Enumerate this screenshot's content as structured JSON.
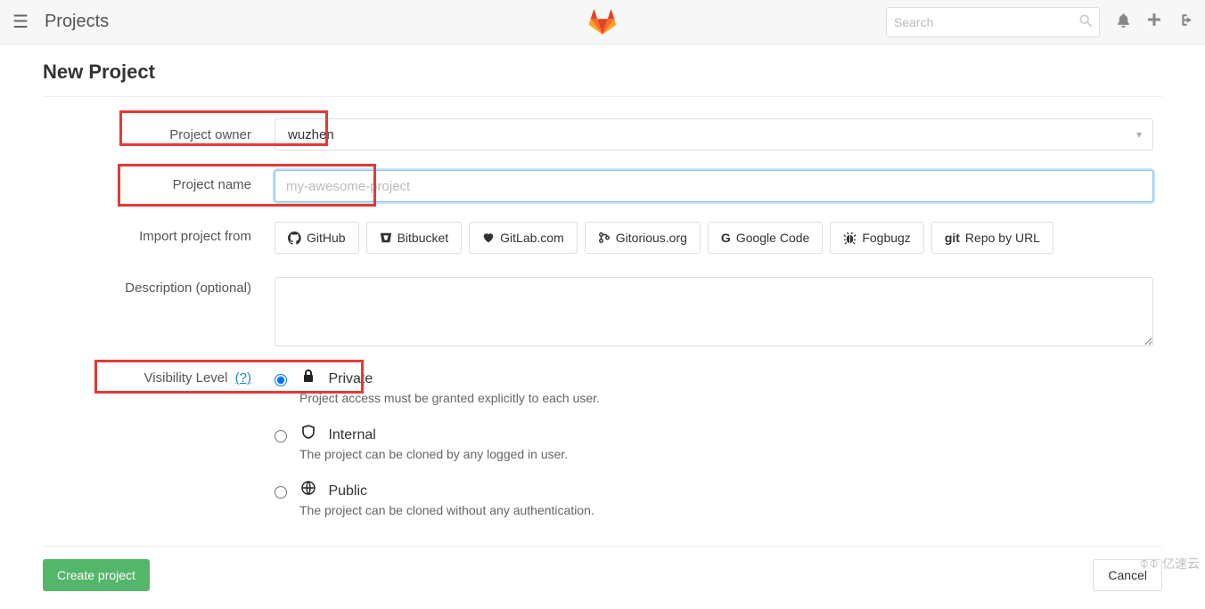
{
  "nav": {
    "title": "Projects",
    "search_placeholder": "Search"
  },
  "page": {
    "title": "New Project"
  },
  "form": {
    "owner": {
      "label": "Project owner",
      "selected_value": "wuzhen"
    },
    "name": {
      "label": "Project name",
      "placeholder": "my-awesome-project",
      "value": ""
    },
    "import": {
      "label": "Import project from",
      "sources": [
        {
          "icon": "github",
          "label": "GitHub"
        },
        {
          "icon": "bitbucket",
          "label": "Bitbucket"
        },
        {
          "icon": "gitlab",
          "label": "GitLab.com"
        },
        {
          "icon": "gitorious",
          "label": "Gitorious.org"
        },
        {
          "icon": "google",
          "label": "Google Code"
        },
        {
          "icon": "fogbugz",
          "label": "Fogbugz"
        },
        {
          "icon": "git",
          "label": "Repo by URL"
        }
      ]
    },
    "description": {
      "label": "Description (optional)",
      "value": ""
    },
    "visibility": {
      "label": "Visibility Level",
      "help": "(?)",
      "options": [
        {
          "value": "private",
          "label": "Private",
          "description": "Project access must be granted explicitly to each user.",
          "checked": true
        },
        {
          "value": "internal",
          "label": "Internal",
          "description": "The project can be cloned by any logged in user.",
          "checked": false
        },
        {
          "value": "public",
          "label": "Public",
          "description": "The project can be cloned without any authentication.",
          "checked": false
        }
      ]
    }
  },
  "actions": {
    "submit": "Create project",
    "cancel": "Cancel"
  },
  "watermark": "亿速云"
}
